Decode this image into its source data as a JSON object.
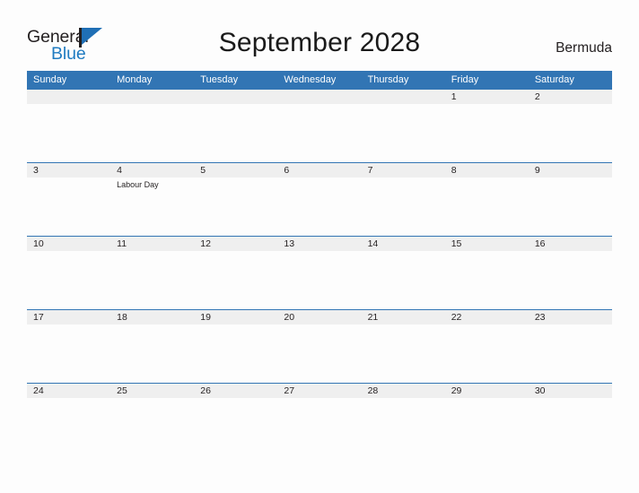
{
  "brand": {
    "word_one": "General",
    "word_two": "Blue",
    "flag_icon": "flag-icon"
  },
  "header": {
    "title": "September 2028",
    "locale": "Bermuda"
  },
  "colors": {
    "header_blue": "#3275b4",
    "brand_blue": "#1f7bc1",
    "band_gray": "#efefef",
    "text_dark": "#231f20",
    "page_bg": "#fdfdfd"
  },
  "calendar": {
    "weekday_headers": [
      "Sunday",
      "Monday",
      "Tuesday",
      "Wednesday",
      "Thursday",
      "Friday",
      "Saturday"
    ],
    "weeks": [
      [
        {
          "day": "",
          "events": []
        },
        {
          "day": "",
          "events": []
        },
        {
          "day": "",
          "events": []
        },
        {
          "day": "",
          "events": []
        },
        {
          "day": "",
          "events": []
        },
        {
          "day": "1",
          "events": []
        },
        {
          "day": "2",
          "events": []
        }
      ],
      [
        {
          "day": "3",
          "events": []
        },
        {
          "day": "4",
          "events": [
            "Labour Day"
          ]
        },
        {
          "day": "5",
          "events": []
        },
        {
          "day": "6",
          "events": []
        },
        {
          "day": "7",
          "events": []
        },
        {
          "day": "8",
          "events": []
        },
        {
          "day": "9",
          "events": []
        }
      ],
      [
        {
          "day": "10",
          "events": []
        },
        {
          "day": "11",
          "events": []
        },
        {
          "day": "12",
          "events": []
        },
        {
          "day": "13",
          "events": []
        },
        {
          "day": "14",
          "events": []
        },
        {
          "day": "15",
          "events": []
        },
        {
          "day": "16",
          "events": []
        }
      ],
      [
        {
          "day": "17",
          "events": []
        },
        {
          "day": "18",
          "events": []
        },
        {
          "day": "19",
          "events": []
        },
        {
          "day": "20",
          "events": []
        },
        {
          "day": "21",
          "events": []
        },
        {
          "day": "22",
          "events": []
        },
        {
          "day": "23",
          "events": []
        }
      ],
      [
        {
          "day": "24",
          "events": []
        },
        {
          "day": "25",
          "events": []
        },
        {
          "day": "26",
          "events": []
        },
        {
          "day": "27",
          "events": []
        },
        {
          "day": "28",
          "events": []
        },
        {
          "day": "29",
          "events": []
        },
        {
          "day": "30",
          "events": []
        }
      ]
    ]
  }
}
